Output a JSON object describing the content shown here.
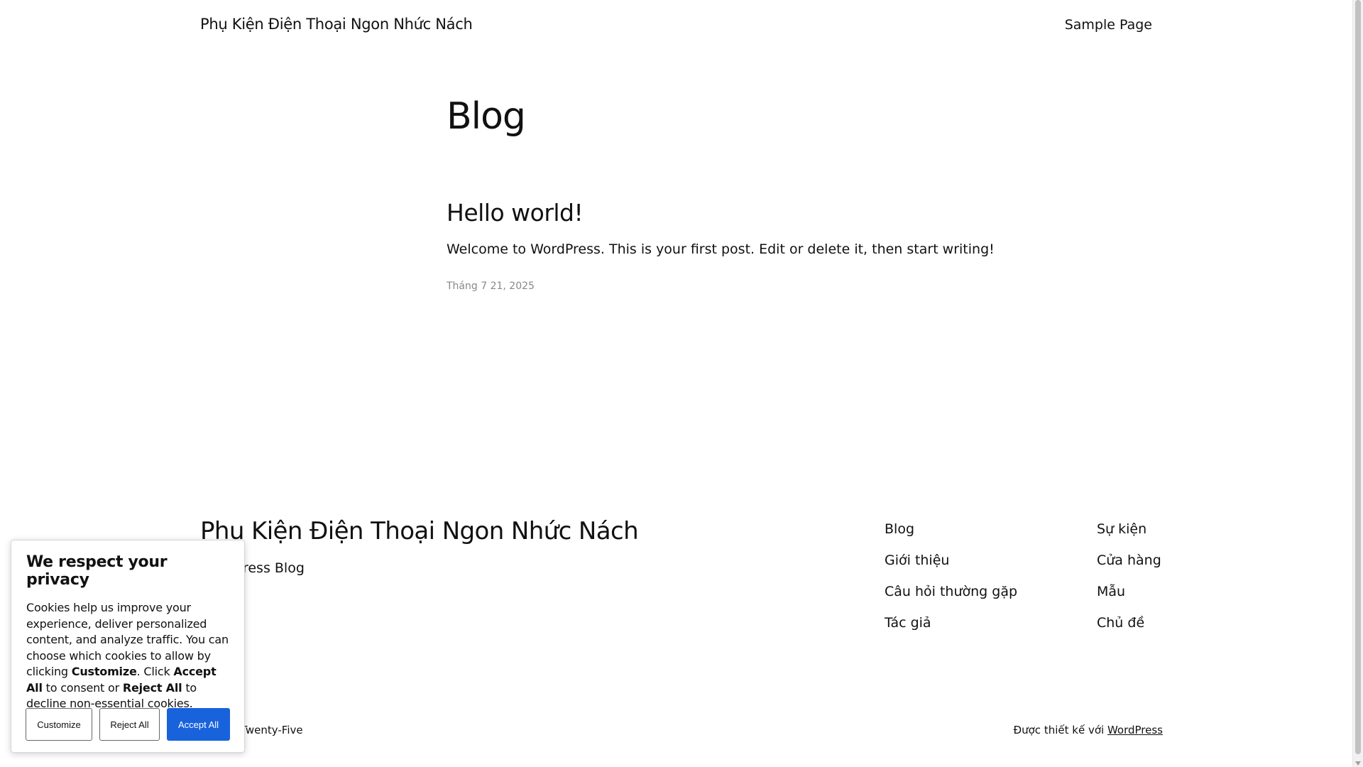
{
  "header": {
    "site_title": "Phụ Kiện Điện Thoại Ngon Nhức Nách",
    "nav_sample_page": "Sample Page"
  },
  "main": {
    "page_title": "Blog",
    "post": {
      "title": "Hello world!",
      "excerpt": "Welcome to WordPress. This is your first post. Edit or delete it, then start writing!",
      "date": "Tháng 7 21, 2025"
    }
  },
  "footer": {
    "site_title": "Phụ Kiện Điện Thoại Ngon Nhức Nách",
    "tagline": "WordPress Blog",
    "nav_col1": [
      "Blog",
      "Giới thiệu",
      "Câu hỏi thường gặp",
      "Tác giả"
    ],
    "nav_col2": [
      "Sự kiện",
      "Cửa hàng",
      "Mẫu",
      "Chủ đề"
    ],
    "theme_credit": "Twenty Twenty-Five",
    "designed_by_prefix": "Được thiết kế với",
    "designed_by_link": "WordPress"
  },
  "cookie_banner": {
    "title": "We respect your privacy",
    "text_part1": "Cookies help us improve your experience, deliver personalized content, and analyze traffic. You can choose which cookies to allow by clicking ",
    "text_bold1": "Customize",
    "text_part2": ". Click ",
    "text_bold2": "Accept All",
    "text_part3": " to consent or ",
    "text_bold3": "Reject All",
    "text_part4": " to decline non-essential cookies.",
    "btn_customize": "Customize",
    "btn_reject": "Reject All",
    "btn_accept": "Accept All",
    "accent_color": "#1863dc"
  }
}
